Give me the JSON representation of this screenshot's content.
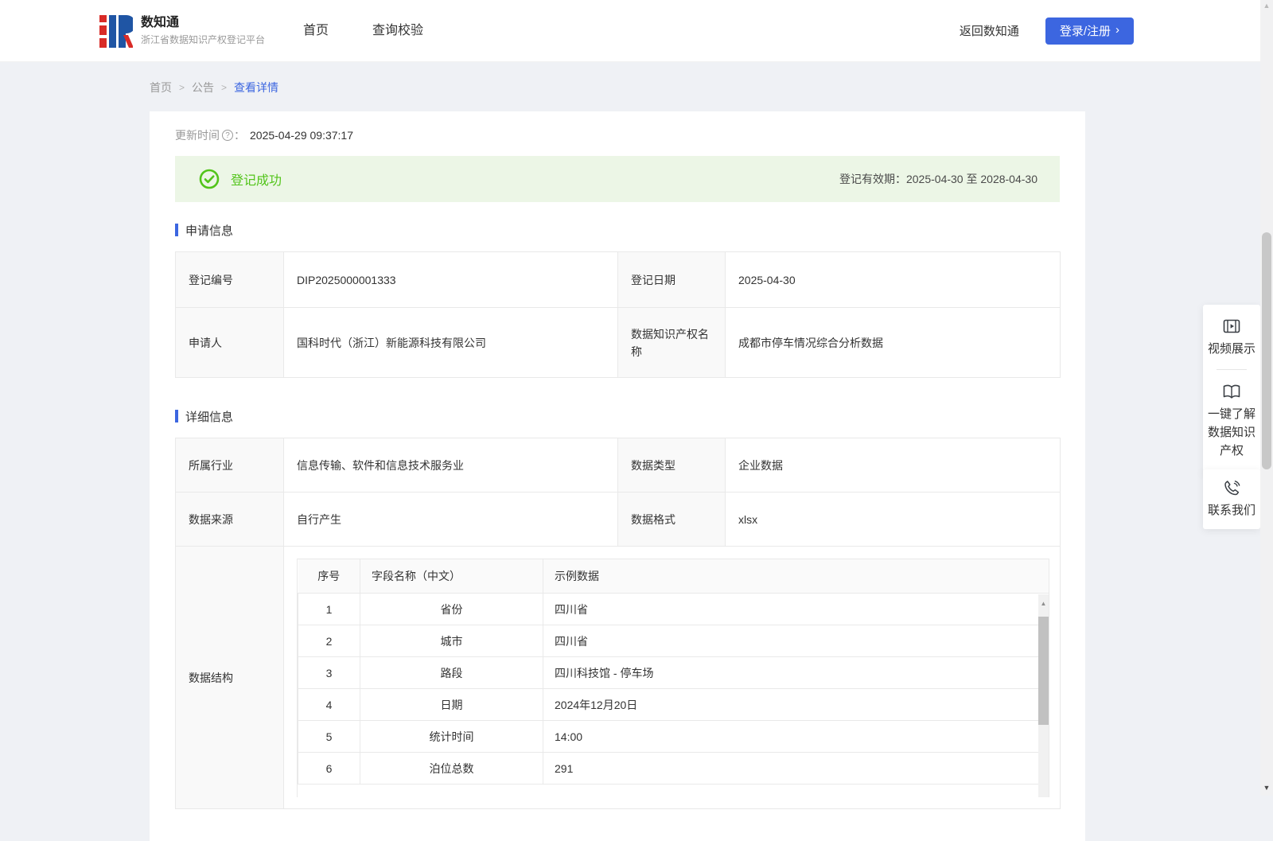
{
  "app": {
    "brand_title": "数知通",
    "brand_subtitle": "浙江省数据知识产权登记平台"
  },
  "header": {
    "nav": [
      {
        "label": "首页"
      },
      {
        "label": "查询校验"
      }
    ],
    "back_link_label": "返回数知通",
    "login_button_label": "登录/注册"
  },
  "breadcrumb": {
    "home": "首页",
    "section": "公告",
    "current": "查看详情",
    "separator": ">"
  },
  "meta": {
    "update_time_label": "更新时间",
    "colon": "：",
    "update_time_value": "2025-04-29 09:37:17"
  },
  "banner": {
    "status_text": "登记成功",
    "validity_label": "登记有效期：",
    "validity_value": "2025-04-30 至 2028-04-30"
  },
  "apply_info": {
    "title": "申请信息",
    "rows": [
      {
        "c0_label": "登记编号",
        "c0_value": "DIP2025000001333",
        "c1_label": "登记日期",
        "c1_value": "2025-04-30"
      },
      {
        "c0_label": "申请人",
        "c0_value": "国科时代（浙江）新能源科技有限公司",
        "c1_label": "数据知识产权名称",
        "c1_value": "成都市停车情况综合分析数据"
      }
    ]
  },
  "detail_info": {
    "title": "详细信息",
    "rows": [
      {
        "c0_label": "所属行业",
        "c0_value": "信息传输、软件和信息技术服务业",
        "c1_label": "数据类型",
        "c1_value": "企业数据"
      },
      {
        "c0_label": "数据来源",
        "c0_value": "自行产生",
        "c1_label": "数据格式",
        "c1_value": "xlsx"
      }
    ],
    "structure_label": "数据结构",
    "structure_table": {
      "headers": [
        "序号",
        "字段名称（中文）",
        "示例数据"
      ],
      "rows": [
        [
          "1",
          "省份",
          "四川省"
        ],
        [
          "2",
          "城市",
          "四川省"
        ],
        [
          "3",
          "路段",
          "四川科技馆 - 停车场"
        ],
        [
          "4",
          "日期",
          "2024年12月20日"
        ],
        [
          "5",
          "统计时间",
          "14:00"
        ],
        [
          "6",
          "泊位总数",
          "291"
        ]
      ]
    }
  },
  "floating": {
    "video_label": "视频展示",
    "guide_label": "一键了解数据知识产权",
    "contact_label": "联系我们"
  },
  "icons": {
    "help_glyph": "?",
    "chevron_right": "›",
    "arrow_up": "▲",
    "arrow_down": "▼"
  },
  "colors": {
    "accent_blue": "#3C66E0",
    "success_green": "#52C41A",
    "banner_bg": "#ECF6E6",
    "page_bg": "#EFF1F5",
    "table_border": "#E9E9E9",
    "label_cell_bg": "#F9F9F9"
  }
}
